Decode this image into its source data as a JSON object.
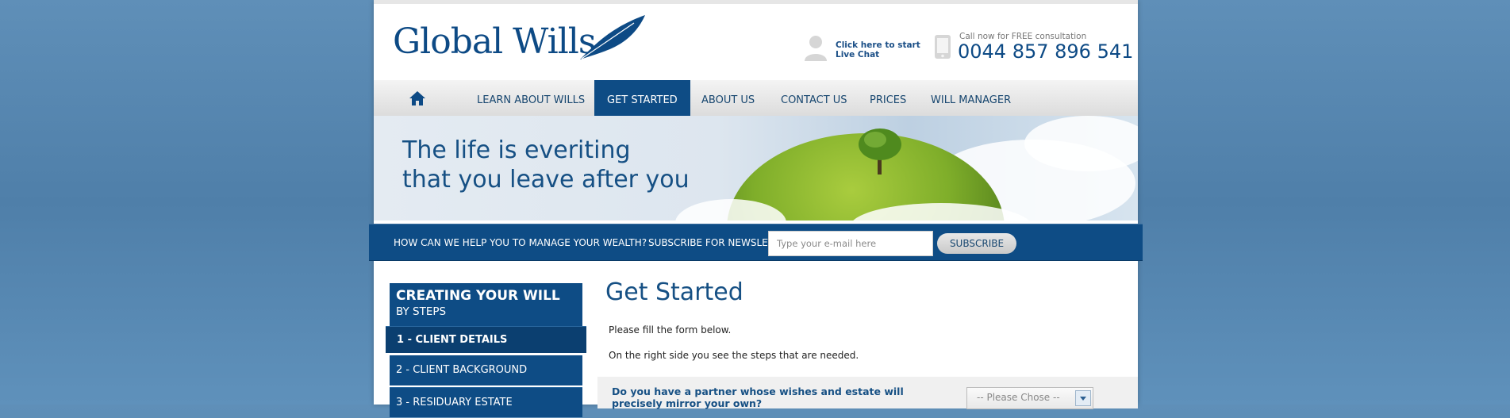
{
  "header": {
    "logo": "Global Wills",
    "chat_line1": "Click here to start",
    "chat_line2": "Live Chat",
    "call_label": "Call now for FREE consultation",
    "phone": "0044 857 896 541"
  },
  "nav": {
    "items": [
      "LEARN ABOUT WILLS",
      "GET STARTED",
      "ABOUT US",
      "CONTACT US",
      "PRICES",
      "WILL MANAGER"
    ],
    "active": "GET STARTED"
  },
  "banner": {
    "line1": "The life is everiting",
    "line2": "that you leave after you"
  },
  "subscribe": {
    "question": "HOW CAN WE HELP YOU TO MANAGE YOUR WEALTH?",
    "label": "SUBSCRIBE FOR NEWSLETTER",
    "placeholder": "Type your e-mail here",
    "button": "SUBSCRIBE"
  },
  "steps": {
    "title": "CREATING YOUR WILL",
    "subtitle": "BY STEPS",
    "items": [
      "1 -  CLIENT DETAILS",
      "2 - CLIENT BACKGROUND",
      "3 - RESIDUARY ESTATE"
    ]
  },
  "main": {
    "title": "Get Started",
    "para1": "Please fill the form below.",
    "para2": "On the right side you see the steps that are needed.",
    "question": "Do you have a partner whose wishes and estate will precisely mirror your own?",
    "select_value": "-- Please Chose --"
  },
  "colors": {
    "brand": "#0e4c85",
    "background": "#5586b0"
  }
}
